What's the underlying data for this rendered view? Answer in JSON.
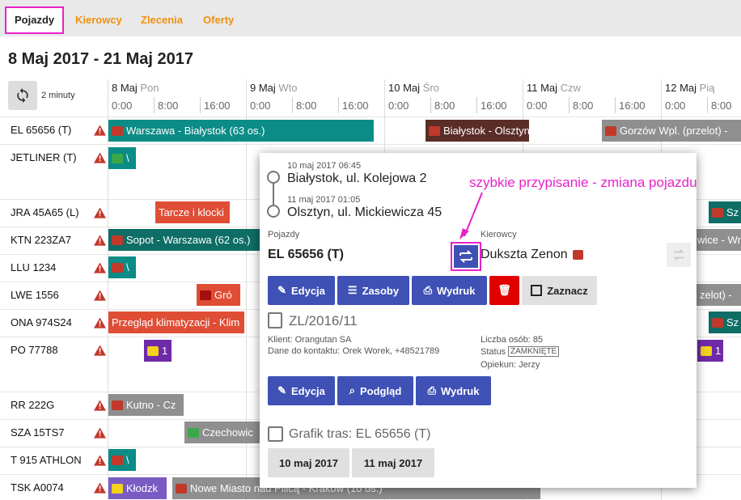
{
  "tabs": [
    "Pojazdy",
    "Kierowcy",
    "Zlecenia",
    "Oferty"
  ],
  "page_title": "8 Maj 2017 - 21 Maj 2017",
  "refresh_label": "2 minuty",
  "days": [
    {
      "day": "8 Maj",
      "wd": "Pon"
    },
    {
      "day": "9 Maj",
      "wd": "Wto"
    },
    {
      "day": "10 Maj",
      "wd": "Śro"
    },
    {
      "day": "11 Maj",
      "wd": "Czw"
    },
    {
      "day": "12 Maj",
      "wd": "Pią"
    }
  ],
  "hours": [
    "0:00",
    "8:00",
    "16:00"
  ],
  "vehicles": [
    "EL 65656 (T)",
    "JETLINER (T)",
    "JRA 45A65 (L)",
    "KTN 223ZA7",
    "LLU 1234",
    "LWE 1556",
    "ONA 974S24",
    "PO 77788",
    "RR 222G",
    "SZA 15TS7",
    "T 915 ATHLON",
    "TSK A0074"
  ],
  "bars": {
    "b1": "Warszawa - Białystok (63 os.)",
    "b2": "Białystok - Olsztyn",
    "b3": "Gorzów Wpl. (przelot) -",
    "b4": "\\",
    "b5": "Tarcze i klocki",
    "b6": "Sz",
    "b7": "Sopot - Warszawa (62 os.)",
    "b8": "wice - Wr",
    "b9": "\\",
    "b10": "Gró",
    "b11": "zelot) -",
    "b12": "Przegląd klimatyzacji - Klim",
    "b13": "Sz",
    "b14": "1",
    "b15": "1",
    "b16": "Kutno - Cz",
    "b17": "Czechowic",
    "b18": "\\",
    "b19": "Kłodzk",
    "b20": "Nowe Miasto nad Pilicą - Kraków (10 os.)"
  },
  "popup": {
    "from_time": "10 maj 2017 06:45",
    "from_addr": "Białystok, ul. Kolejowa 2",
    "to_time": "11 maj 2017 01:05",
    "to_addr": "Olsztyn, ul. Mickiewicza 45",
    "vehicle_label": "Pojazdy",
    "vehicle": "EL 65656 (T)",
    "driver_label": "Kierowcy",
    "driver": "Dukszta Zenon",
    "btn_edit": "Edycja",
    "btn_resources": "Zasoby",
    "btn_print": "Wydruk",
    "btn_mark": "Zaznacz",
    "order_no": "ZL/2016/11",
    "client": "Klient: Orangutan SA",
    "contact": "Dane do kontaktu: Orek Worek, +48521789",
    "persons": "Liczba osób: 85",
    "status_label": "Status",
    "status": "ZAMKNIĘTE",
    "guardian": "Opiekun: Jerzy",
    "btn_edit2": "Edycja",
    "btn_preview": "Podgląd",
    "btn_print2": "Wydruk",
    "schedule": "Grafik tras: EL 65656 (T)",
    "date1": "10 maj 2017",
    "date2": "11 maj 2017"
  },
  "annotation": "szybkie przypisanie - zmiana pojazdu",
  "colors": {
    "accent": "#3f51b5",
    "highlight": "#e622c8",
    "tab_orange": "#f0900c"
  }
}
